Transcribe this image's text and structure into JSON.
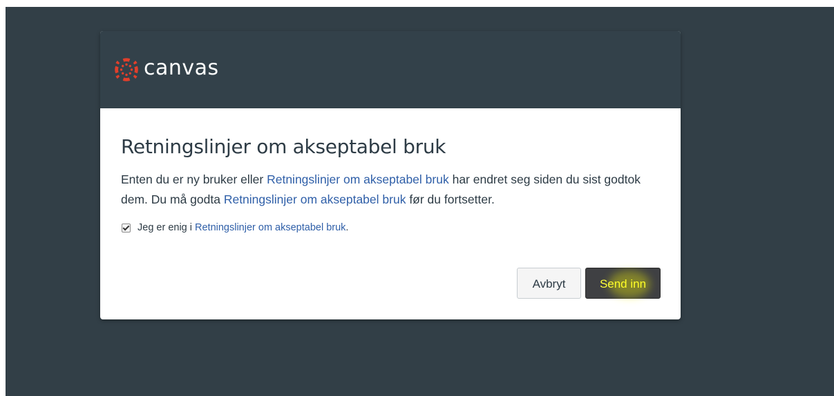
{
  "brand": {
    "name": "canvas",
    "icon": "canvas-logo-icon",
    "color": "#e13f2b"
  },
  "modal": {
    "title": "Retningslinjer om akseptabel bruk",
    "intro": {
      "part1": "Enten du er ny bruker eller ",
      "link1": "Retningslinjer om akseptabel bruk",
      "part2": " har endret seg siden du sist godtok dem. Du må godta ",
      "link2": "Retningslinjer om akseptabel bruk",
      "part3": " før du fortsetter."
    },
    "agree": {
      "checked": true,
      "label": "Jeg er enig i",
      "link": "Retningslinjer om akseptabel bruk",
      "suffix": "."
    },
    "buttons": {
      "cancel": "Avbryt",
      "submit": "Send inn"
    }
  },
  "colors": {
    "backdrop": "#323f47",
    "header": "#33414a",
    "link": "#2f5fa8",
    "submit_bg": "#3f4043",
    "submit_text": "#ffff3b"
  }
}
